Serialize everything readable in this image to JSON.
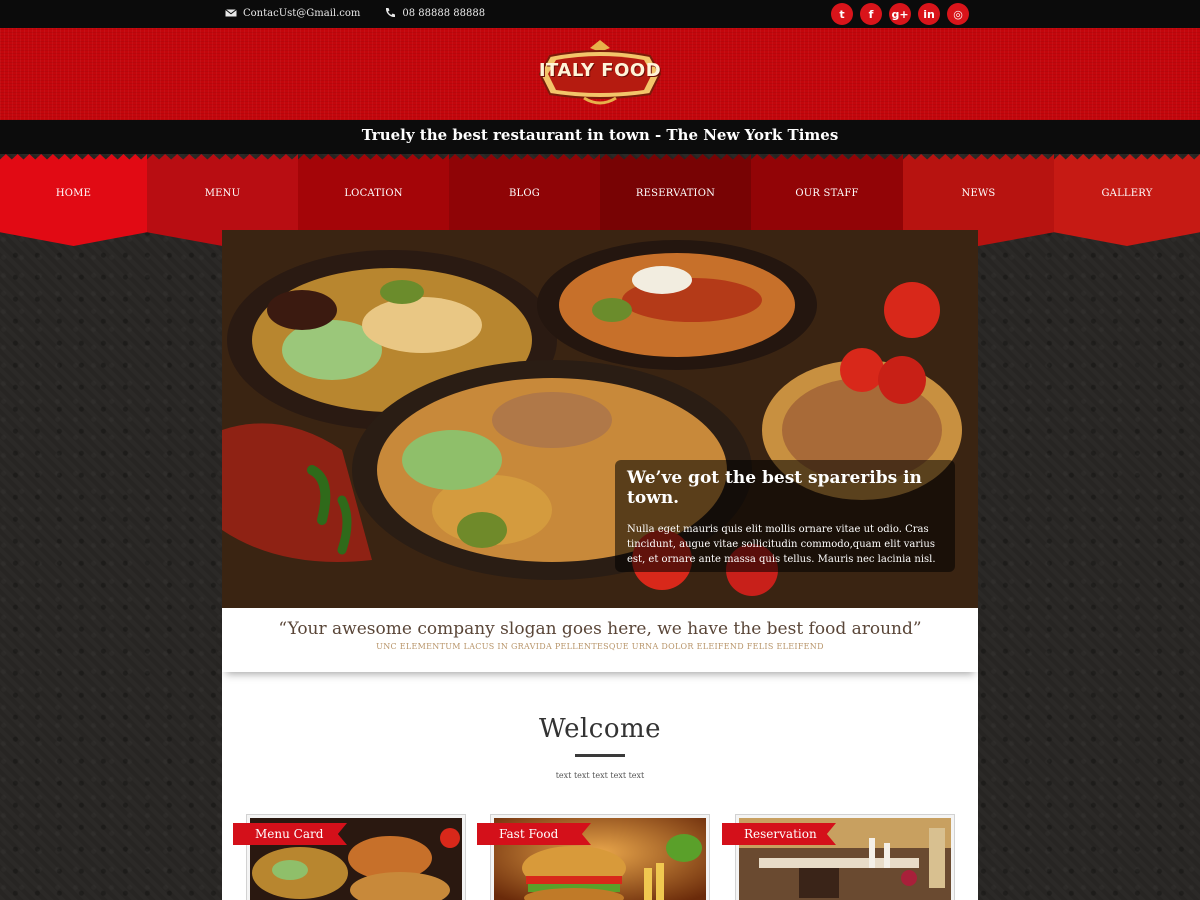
{
  "topbar": {
    "email": "ContacUst@Gmail.com",
    "phone": "08 88888 88888",
    "social": [
      {
        "name": "twitter",
        "glyph": "t"
      },
      {
        "name": "facebook",
        "glyph": "f"
      },
      {
        "name": "google-plus",
        "glyph": "g+"
      },
      {
        "name": "linkedin",
        "glyph": "in"
      },
      {
        "name": "instagram",
        "glyph": "◎"
      }
    ]
  },
  "header": {
    "logo_text": "ITALY FOOD",
    "tagline": "Truely the best restaurant in town - The New York Times"
  },
  "nav": {
    "items": [
      {
        "label": "HOME",
        "color": "#e10a14"
      },
      {
        "label": "MENU",
        "color": "#b80d12"
      },
      {
        "label": "LOCATION",
        "color": "#a40508"
      },
      {
        "label": "BLOG",
        "color": "#8f0406"
      },
      {
        "label": "RESERVATION",
        "color": "#780304"
      },
      {
        "label": "OUR STAFF",
        "color": "#920406"
      },
      {
        "label": "NEWS",
        "color": "#b71310"
      },
      {
        "label": "GALLERY",
        "color": "#c61a14"
      }
    ]
  },
  "hero": {
    "caption_title": "We’ve got the best spareribs in town.",
    "caption_text": "Nulla eget mauris quis elit mollis ornare vitae ut odio. Cras tincidunt, augue vitae sollicitudin commodo,quam elit varius est, et ornare ante massa quis tellus. Mauris nec lacinia nisl."
  },
  "slogan": {
    "text": "“Your awesome company slogan goes here, we have the best food around”",
    "sub": "UNC ELEMENTUM LACUS IN GRAVIDA PELLENTESQUE URNA DOLOR ELEIFEND FELIS ELEIFEND"
  },
  "welcome": {
    "title": "Welcome",
    "sub": "text text text text text"
  },
  "cards": [
    {
      "label": "Menu Card"
    },
    {
      "label": "Fast Food"
    },
    {
      "label": "Reservation"
    }
  ]
}
